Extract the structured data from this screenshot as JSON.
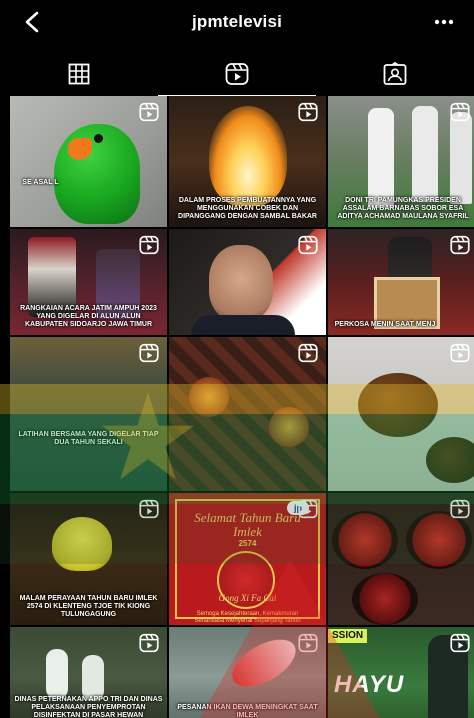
{
  "header": {
    "title": "jpmtelevisi",
    "back_icon": "chevron-left-icon",
    "more_icon": "more-horizontal-icon"
  },
  "tabs": [
    {
      "name": "grid",
      "icon": "grid-icon",
      "active": false
    },
    {
      "name": "reels",
      "icon": "reels-icon",
      "active": true
    },
    {
      "name": "tagged",
      "icon": "tagged-icon",
      "active": false
    }
  ],
  "posts": [
    {
      "caption": "SE ASAL L",
      "bg": "#a5a8a3"
    },
    {
      "caption": "DALAM PROSES PEMBUATANNYA YANG MENGGUNAKAN COBEK DAN DIPANGGANG DENGAN SAMBAL BAKAR",
      "bg": "#3a2a1c"
    },
    {
      "caption": "DONI TRI PAMUNGKAS PRESIDEN ASSALAM BARNABAS SOBOR ESA ADITYA ACHAMAD MAULANA SYAFRIL",
      "bg": "#6e7a57"
    },
    {
      "caption": "RANGKAIAN ACARA JATIM AMPUH 2023 YANG DIGELAR DI ALUN ALUN KABUPATEN SIDOARJO JAWA TIMUR",
      "bg": "#3b1d22"
    },
    {
      "caption": "",
      "bg": "#2a2623"
    },
    {
      "caption": "PERKOSA MENIN SAAT MENJ",
      "bg": "#5a1f1d"
    },
    {
      "caption": "LATIHAN BERSAMA YANG DIGELAR TIAP DUA TAHUN SEKALI",
      "bg": "#2f3b34"
    },
    {
      "caption": "",
      "bg": "#3a1f19"
    },
    {
      "caption": "",
      "bg": "#c9c9c5"
    },
    {
      "caption": "MALAM PERAYAAN TAHUN BARU IMLEK 2574 DI KLENTENG TJOE TIK KIONG TULUNGAGUNG",
      "bg": "#3b2a16"
    },
    {
      "caption": "",
      "bg": "#b91a1d"
    },
    {
      "caption": "",
      "bg": "#2c1e1a"
    },
    {
      "caption": "DINAS PETERNAKAN APPO TRI DAN DINAS PELAKSANAAN PENYEMPROTAN DISINFEKTAN DI PASAR HEWAN",
      "bg": "#4a5a42"
    },
    {
      "caption": "PESANAN IKAN DEWA MENINGKAT SAAT IMLEK",
      "bg": "#7b8d86"
    },
    {
      "caption": "",
      "bg": "#3a7b3d"
    }
  ],
  "poster": {
    "line1": "Selamat Tahun Baru Imlek",
    "line2": "2574",
    "line3": "Gong Xi Fa Cai",
    "line4": "Semoga Kesejahteraan, Kemakmuran Senantiasa Menyertai Sepanjang Tahun",
    "badge": "jp"
  },
  "overlay_text": {
    "sport_tag": "SSION",
    "sport_text": "HAYU"
  }
}
